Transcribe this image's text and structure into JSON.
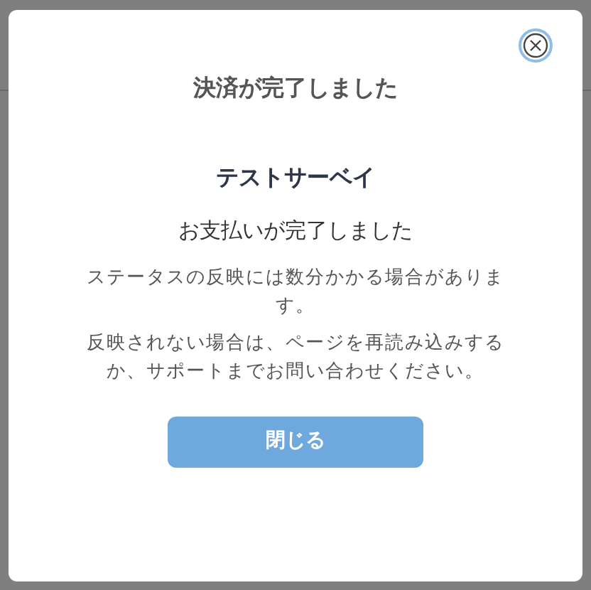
{
  "dialog": {
    "title": "決済が完了しました",
    "survey_name": "テストサーベイ",
    "message": "お支払いが完了しました",
    "notes": [
      "ステータスの反映には数分かかる場合があります。",
      "反映されない場合は、ページを再読み込みするか、サポートまでお問い合わせください。"
    ],
    "button": "閉じる"
  }
}
